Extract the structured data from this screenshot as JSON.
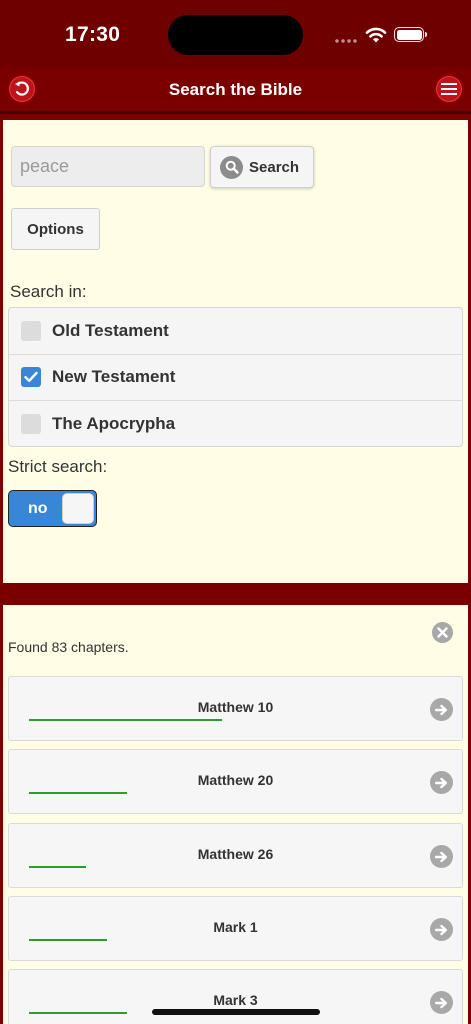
{
  "status_bar": {
    "time": "17:30"
  },
  "header": {
    "title": "Search the Bible",
    "back_icon": "undo-icon",
    "menu_icon": "hamburger-icon"
  },
  "search": {
    "value": "",
    "placeholder": "peace",
    "button_label": "Search",
    "options_label": "Options"
  },
  "search_in": {
    "label": "Search in:",
    "items": [
      {
        "label": "Old Testament",
        "checked": false
      },
      {
        "label": "New Testament",
        "checked": true
      },
      {
        "label": "The Apocrypha",
        "checked": false
      }
    ]
  },
  "strict_search": {
    "label": "Strict search:",
    "value": "no"
  },
  "results": {
    "summary": "Found 83 chapters.",
    "items": [
      {
        "title": "Matthew 10",
        "relevance": 0.47
      },
      {
        "title": "Matthew 20",
        "relevance": 0.24
      },
      {
        "title": "Matthew 26",
        "relevance": 0.14
      },
      {
        "title": "Mark 1",
        "relevance": 0.19
      },
      {
        "title": "Mark 3",
        "relevance": 0.24
      }
    ]
  },
  "colors": {
    "header": "#7a0000",
    "panel": "#fffde6",
    "accent": "#3a86d6",
    "relevance_bar": "#2f9a2f"
  }
}
